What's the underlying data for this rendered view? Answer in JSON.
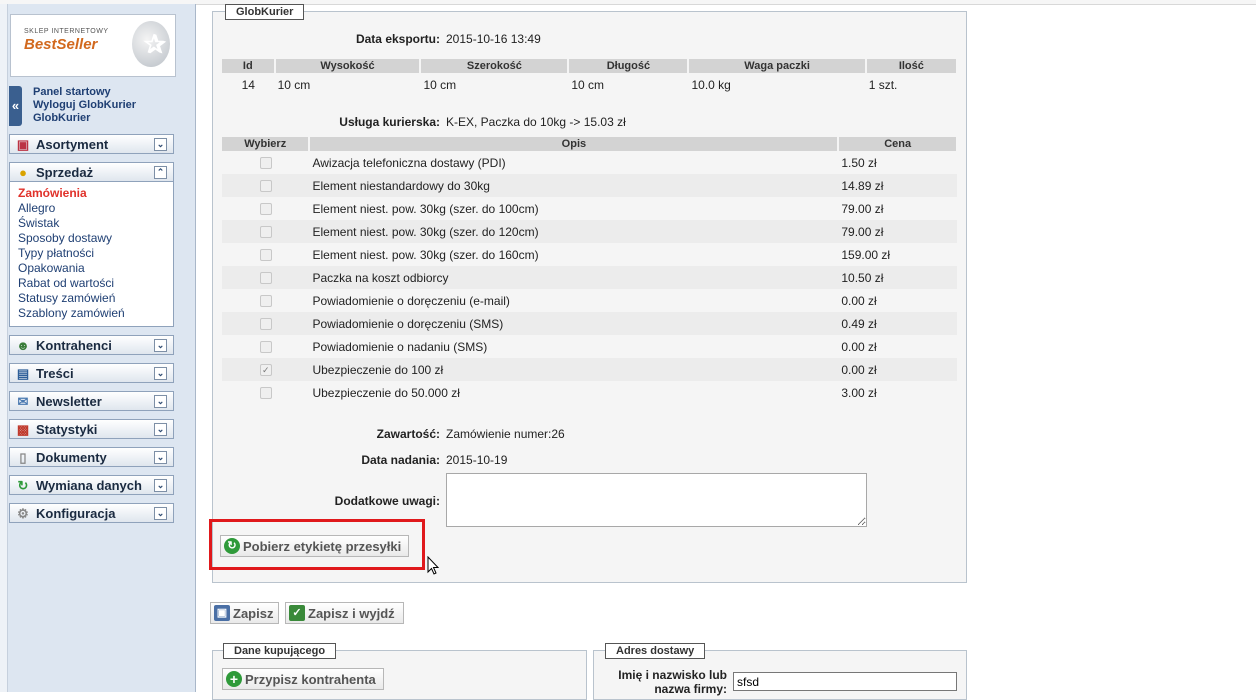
{
  "sidebar": {
    "logo_small": "SKLEP INTERNETOWY",
    "logo_big": "BestSeller",
    "user_links": [
      "Panel startowy",
      "Wyloguj GlobKurier",
      "GlobKurier"
    ],
    "menus": [
      {
        "label": "Asortyment",
        "icon": "boxes-icon"
      },
      {
        "label": "Sprzedaż",
        "icon": "coins-icon",
        "expanded": true
      },
      {
        "label": "Kontrahenci",
        "icon": "users-icon"
      },
      {
        "label": "Treści",
        "icon": "book-icon"
      },
      {
        "label": "Newsletter",
        "icon": "envelope-icon"
      },
      {
        "label": "Statystyki",
        "icon": "bar-chart-icon"
      },
      {
        "label": "Dokumenty",
        "icon": "document-icon"
      },
      {
        "label": "Wymiana danych",
        "icon": "sync-icon"
      },
      {
        "label": "Konfiguracja",
        "icon": "gear-icon"
      }
    ],
    "sales_items": [
      "Zamówienia",
      "Allegro",
      "Świstak",
      "Sposoby dostawy",
      "Typy płatności",
      "Opakowania",
      "Rabat od wartości",
      "Statusy zamówień",
      "Szablony zamówień"
    ],
    "active_item": "Zamówienia"
  },
  "globkurier": {
    "legend": "GlobKurier",
    "export_label": "Data eksportu:",
    "export_value": "2015-10-16 13:49",
    "package_headers": [
      "Id",
      "Wysokość",
      "Szerokość",
      "Długość",
      "Waga paczki",
      "Ilość"
    ],
    "package_row": [
      "14",
      "10 cm",
      "10 cm",
      "10 cm",
      "10.0 kg",
      "1 szt."
    ],
    "service_label": "Usługa kurierska:",
    "service_value": "K-EX, Paczka do 10kg -> 15.03 zł",
    "options_headers": [
      "Wybierz",
      "Opis",
      "Cena"
    ],
    "options": [
      {
        "desc": "Awizacja telefoniczna dostawy (PDI)",
        "price": "1.50 zł",
        "checked": false
      },
      {
        "desc": "Element niestandardowy do 30kg",
        "price": "14.89 zł",
        "checked": false
      },
      {
        "desc": "Element niest. pow. 30kg (szer. do 100cm)",
        "price": "79.00 zł",
        "checked": false
      },
      {
        "desc": "Element niest. pow. 30kg (szer. do 120cm)",
        "price": "79.00 zł",
        "checked": false
      },
      {
        "desc": "Element niest. pow. 30kg (szer. do 160cm)",
        "price": "159.00 zł",
        "checked": false
      },
      {
        "desc": "Paczka na koszt odbiorcy",
        "price": "10.50 zł",
        "checked": false
      },
      {
        "desc": "Powiadomienie o doręczeniu (e-mail)",
        "price": "0.00 zł",
        "checked": false
      },
      {
        "desc": "Powiadomienie o doręczeniu (SMS)",
        "price": "0.49 zł",
        "checked": false
      },
      {
        "desc": "Powiadomienie o nadaniu (SMS)",
        "price": "0.00 zł",
        "checked": false
      },
      {
        "desc": "Ubezpieczenie do 100 zł",
        "price": "0.00 zł",
        "checked": true
      },
      {
        "desc": "Ubezpieczenie do 50.000 zł",
        "price": "3.00 zł",
        "checked": false
      }
    ],
    "content_label": "Zawartość:",
    "content_value": "Zamówienie numer:26",
    "send_date_label": "Data nadania:",
    "send_date_value": "2015-10-19",
    "notes_label": "Dodatkowe uwagi:",
    "notes_value": "",
    "download_label_button": "Pobierz etykietę przesyłki"
  },
  "actions": {
    "save": "Zapisz",
    "save_exit": "Zapisz i wyjdź"
  },
  "buyer": {
    "legend": "Dane kupującego",
    "assign_button": "Przypisz kontrahenta"
  },
  "delivery": {
    "legend": "Adres dostawy",
    "name_label_line1": "Imię i nazwisko lub",
    "name_label_line2": "nazwa firmy:",
    "name_value": "sfsd"
  },
  "colors": {
    "highlight": "#e0191c",
    "active_menu": "#e0312a",
    "link": "#1f3f73"
  }
}
